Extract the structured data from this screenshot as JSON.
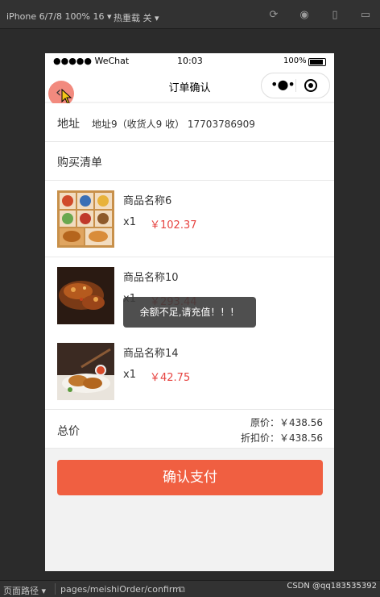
{
  "devtools": {
    "device": "iPhone 6/7/8 100% 16 ▾",
    "hot_reload": "热重载 关 ▾",
    "page_path_label": "页面路径 ▾",
    "page_path": "pages/meishiOrder/confirm",
    "credit": "CSDN @qq183535392"
  },
  "statusbar": {
    "carrier": "●●●●● WeChat",
    "time": "10:03",
    "battery": "100%"
  },
  "navbar": {
    "title": "订单确认",
    "back_icon": "chevron-left-icon",
    "more_icon": "more-dots-icon",
    "close_icon": "target-close-icon"
  },
  "address": {
    "label": "地址",
    "value": "地址9（收货人9 收） 17703786909"
  },
  "purchase_list": {
    "title": "购买清单",
    "items": [
      {
        "name": "商品名称6",
        "qty": "x1",
        "price": "￥102.37"
      },
      {
        "name": "商品名称10",
        "qty": "x1",
        "price": "￥293.44"
      },
      {
        "name": "商品名称14",
        "qty": "x1",
        "price": "￥42.75"
      }
    ]
  },
  "total": {
    "label": "总价",
    "original": "原价：￥438.56",
    "discounted": "折扣价：￥438.56"
  },
  "pay_button": "确认支付",
  "toast": "余额不足,请充值！！！",
  "colors": {
    "price": "#e64340",
    "pay_button": "#f05f41",
    "back_button": "#f28a7e"
  }
}
